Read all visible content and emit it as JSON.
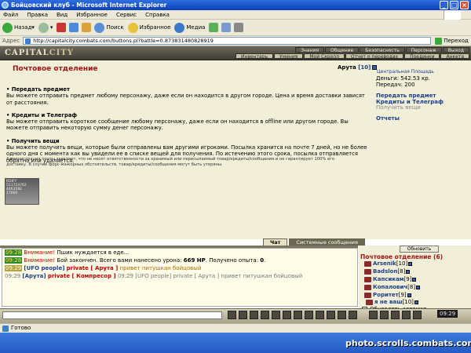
{
  "window": {
    "title": "Бойцовский клуб - Microsoft Internet Explorer"
  },
  "menu": [
    "Файл",
    "Правка",
    "Вид",
    "Избранное",
    "Сервис",
    "Справка"
  ],
  "toolbar": {
    "back": "Назад",
    "search": "Поиск",
    "favorites": "Избранное",
    "media": "Медиа"
  },
  "address": {
    "label": "Адрес",
    "url": "http://capitalcity.combats.com/buttons.pl?battle=0.873831480828919",
    "go": "Переход"
  },
  "game": {
    "logo_a": "CAPITAL",
    "logo_b": "CITY",
    "nav_top": [
      "Знания",
      "Общение",
      "Безопасность",
      "Персонаж",
      "Выход"
    ],
    "nav_bottom": [
      "Инвентарь",
      "Умения",
      "Мой Скролл",
      "Отчет о переводах",
      "Поединки",
      "Анкета"
    ]
  },
  "post": {
    "title": "Почтовое отделение",
    "user": "Арута",
    "level": "[10]",
    "location": "Центральная Площадь",
    "money": "Деньги: 542.53 кр.",
    "transfers": "Передач: 200",
    "links": [
      "Передать предмет",
      "Кредиты и Телеграф"
    ],
    "get_link": "Получить вещи",
    "reports": "Отчеты",
    "sections": [
      {
        "title": "• Передать предмет",
        "text": "Вы можете отправить предмет любому персонажу, даже если он находится в другом городе. Цена и время доставки зависят от расстояния."
      },
      {
        "title": "• Кредиты и Телеграф",
        "text": "Вы можете отправить короткое сообщение любому персонажу, даже если он находится в offline или другом городе. Вы можете отправить некоторую сумму денег персонажу."
      },
      {
        "title": "• Получить вещи",
        "text": "Вы можете получить вещи, которые были отправлены вам другими игроками. Посылка хранится на почте 7 дней, но не более одного дня с момента как вы увидели ее в списке вещей для получения. По истечению этого срока, посылка отправляется обратно или удаляется."
      }
    ],
    "admin": "Администрация почты заявляет, что не несет ответственности за хранимый или пересылаемый товар/кредиты/сообщения и не гарантирует 100% его доставку. В случае форс-мажорных обстоятельств, товар/кредиты/сообщения могут быть утеряны.",
    "counter": [
      "RDIFY",
      "511724762",
      "4463582",
      "17660"
    ]
  },
  "chat": {
    "tab_chat": "Чат",
    "tab_system": "Системные сообщения",
    "lines": [
      {
        "time": "09:28",
        "warn": "Внимание!",
        "text": " Пшик нуждается в еде..."
      },
      {
        "time": "09:28",
        "warn": "Внимание!",
        "text": " Бой закончен. Всего вами нанесено урона: ",
        "hp": "669 HP",
        "text2": ". Получено опыта: ",
        "exp": "0",
        "text3": "."
      },
      {
        "time": "09:29",
        "name": "[UFO people]",
        "prv": "private [ Арута ]",
        "msg": " привет питушкан бойцовый"
      },
      {
        "time": "09:29",
        "name": "[Арута]",
        "prv": "private [ Компресор ]",
        "msg": " 09:29 [UFO people] private [ Арута ] привет питушкан бойцовый"
      }
    ]
  },
  "online": {
    "refresh": "Обновить",
    "title": "Почтовое отделение (6)",
    "users": [
      {
        "name": "Arsenik",
        "lvl": "[10]"
      },
      {
        "name": "Badslon",
        "lvl": "[8]"
      },
      {
        "name": "Капсикам",
        "lvl": "[9]"
      },
      {
        "name": "Копалович",
        "lvl": "[8]"
      },
      {
        "name": "Роритет",
        "lvl": "[9]"
      },
      {
        "name": "я не ваш",
        "lvl": "[10]"
      }
    ],
    "auto": "Обновлять автомат."
  },
  "clock": "09:29",
  "status": "Готово",
  "watermark": "photo.scrolls.combats.com"
}
